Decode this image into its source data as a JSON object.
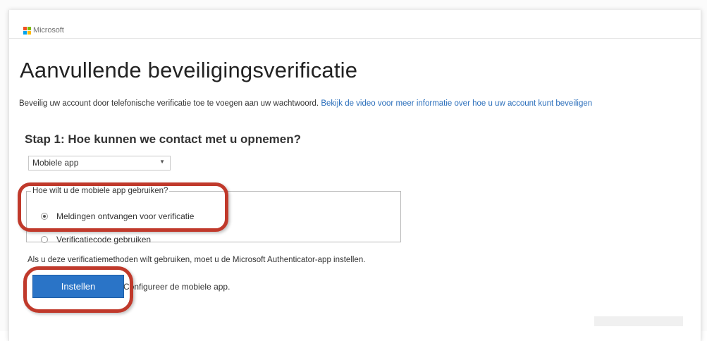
{
  "brand": {
    "name": "Microsoft",
    "colors": [
      "#f25022",
      "#7fba00",
      "#00a4ef",
      "#ffb900"
    ]
  },
  "page": {
    "title": "Aanvullende beveiligingsverificatie",
    "intro_text": "Beveilig uw account door telefonische verificatie toe te voegen aan uw wachtwoord.",
    "intro_link": "Bekijk de video voor meer informatie over hoe u uw account kunt beveiligen",
    "step_heading": "Stap 1: Hoe kunnen we contact met u opnemen?"
  },
  "method_select": {
    "selected": "Mobiele app",
    "arrow": "▼"
  },
  "mobile_app_group": {
    "legend": "Hoe wilt u de mobiele app gebruiken?",
    "options": [
      {
        "label": "Meldingen ontvangen voor verificatie",
        "checked": true
      },
      {
        "label": "Verificatiecode gebruiken",
        "checked": false
      }
    ]
  },
  "note": "Als u deze verificatiemethoden wilt gebruiken, moet u de Microsoft Authenticator-app instellen.",
  "setup": {
    "button_label": "Instellen",
    "hint": "Configureer de mobiele app."
  },
  "annotations": {
    "highlight_color": "#c0392b"
  }
}
